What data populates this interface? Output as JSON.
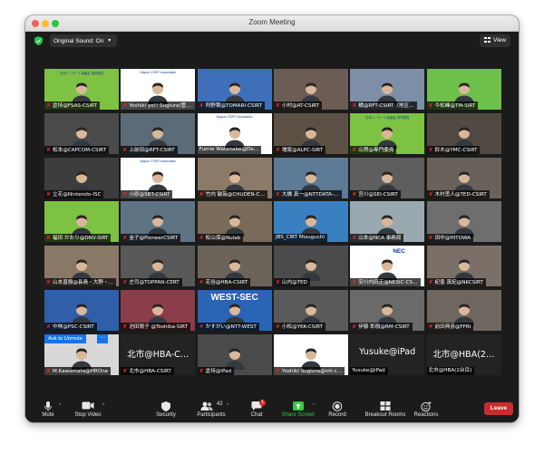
{
  "window": {
    "title": "Zoom Meeting"
  },
  "topbar": {
    "original_sound_label": "Original Sound: On",
    "view_label": "View"
  },
  "tiles": [
    {
      "name": "倉持@FSAS-CSIRT",
      "muted": true,
      "bg": "#7dc242",
      "banner": "日本シーサート協議会 運営委員"
    },
    {
      "name": "Yoshiki yo!! Sugiura(管&…",
      "muted": true,
      "bg": "#ffffff",
      "active": true,
      "banner": "Nippon CSIRT Association"
    },
    {
      "name": "阿野賢@TOMARI-CSIRT",
      "muted": true,
      "bg": "#3f6fb8"
    },
    {
      "name": "小村@AT-CSIRT",
      "muted": true,
      "bg": "#6b5d55"
    },
    {
      "name": "橘@RFT-CSIRT（地区…",
      "muted": true,
      "bg": "#7c8fa6"
    },
    {
      "name": "今松峰@TM-SIRT",
      "muted": true,
      "bg": "#6dc04a"
    },
    {
      "name": "松本@CAPCOM-CSIRT",
      "muted": true,
      "bg": "#4a4a4a"
    },
    {
      "name": "上前田@RFT-CSIRT",
      "muted": true,
      "bg": "#5c6b78"
    },
    {
      "name": "Fumie Watanabe@De…",
      "muted": false,
      "bg": "#ffffff",
      "banner": "Nippon CSIRT Association"
    },
    {
      "name": "増尾@ALPC-SIRT",
      "muted": true,
      "bg": "#5d5145"
    },
    {
      "name": "山賀@専門委員",
      "muted": true,
      "bg": "#7dc242",
      "banner": "日本シーサート協議会 専門委員"
    },
    {
      "name": "鈴木@YMC-CSIRT",
      "muted": true,
      "bg": "#514a43"
    },
    {
      "name": "立花@Nintendo-ISC",
      "muted": true,
      "bg": "#3d3d3d"
    },
    {
      "name": "小原@SBT-CSIRT",
      "muted": true,
      "bg": "#ffffff",
      "banner": "Nippon CSIRT Association"
    },
    {
      "name": "竹内 敏哉@CHUDEN-C…",
      "muted": true,
      "bg": "#8c7a69"
    },
    {
      "name": "大橋 真一@NTTDATA-…",
      "muted": true,
      "bg": "#5d7a96"
    },
    {
      "name": "宮川@SEI-CSIRT",
      "muted": true,
      "bg": "#5e5e5e"
    },
    {
      "name": "木村勇人@TED-CSIRT",
      "muted": true,
      "bg": "#6a625a"
    },
    {
      "name": "福田 かおり@DNV-SIRT",
      "muted": true,
      "bg": "#7dc242"
    },
    {
      "name": "金子@PioneerCSIRT",
      "muted": true,
      "bg": "#5e7384"
    },
    {
      "name": "松山保@Nulab",
      "muted": true,
      "bg": "#7a6a5a"
    },
    {
      "name": "JBS_CIRT Mizuguchi",
      "muted": false,
      "bg": "#3a7fc0"
    },
    {
      "name": "山本@NCA 事務局",
      "muted": true,
      "bg": "#9aa8b0"
    },
    {
      "name": "田中@HITOWA",
      "muted": true,
      "bg": "#6e6e6e"
    },
    {
      "name": "山本直樹@長島・大野・…",
      "muted": true,
      "bg": "#8a7866"
    },
    {
      "name": "庄司@TOPPAN-CERT",
      "muted": true,
      "bg": "#585858"
    },
    {
      "name": "花谷@HBA-CSIRT",
      "muted": true,
      "bg": "#6c6459"
    },
    {
      "name": "山内@TED",
      "muted": true,
      "bg": "#4b4b4b"
    },
    {
      "name": "安川内田正@NESIC-CS…",
      "muted": true,
      "bg": "#ffffff",
      "nec": "NEC"
    },
    {
      "name": "紀香 真紀@NKCSIRT",
      "muted": true,
      "bg": "#7a7068"
    },
    {
      "name": "中林@PSC-CSIRT",
      "muted": true,
      "bg": "#2f5fa8"
    },
    {
      "name": "池田陽子 @Toshiba-SIRT",
      "muted": true,
      "bg": "#8b3d4a"
    },
    {
      "name": "かすがい@NTT-WEST",
      "muted": true,
      "bg": "#2a64b5",
      "westsec": "WEST-SEC"
    },
    {
      "name": "小松@YKK-CSIRT",
      "muted": true,
      "bg": "#5a5a5a"
    },
    {
      "name": "伊藤 彰樹@RM-CSIRT",
      "muted": true,
      "bg": "#6a6a6a"
    },
    {
      "name": "前田典彦@FFRI",
      "muted": true,
      "bg": "#6f675f"
    },
    {
      "name": "M.Kawamata@HROne",
      "muted": true,
      "bg": "#d8d8d8",
      "popup": "Ask to Unmute",
      "popup_more": "⋯"
    },
    {
      "name": "北市@HBA-CSIRT",
      "muted": true,
      "bg": "#232323",
      "bigname": "北市@HBA-C…"
    },
    {
      "name": "倉持@iPad",
      "muted": true,
      "bg": "#4a4a4a"
    },
    {
      "name": "Yoshiki Sugiura@ntt-c…",
      "muted": true,
      "bg": "#ffffff"
    },
    {
      "name": "Yusuke@iPad",
      "muted": false,
      "bg": "#232323",
      "bigname": "Yusuke@iPad"
    },
    {
      "name": "北市@HBA(2台目)",
      "muted": false,
      "bg": "#232323",
      "bigname": "北市@HBA(2…"
    }
  ],
  "toolbar": {
    "mute": "Mute",
    "stop_video": "Stop Video",
    "security": "Security",
    "participants": "Participants",
    "participants_count": "42",
    "chat": "Chat",
    "chat_badge": "1",
    "share_screen": "Share Screen",
    "record": "Record",
    "breakout_rooms": "Breakout Rooms",
    "reactions": "Reactions",
    "leave": "Leave"
  },
  "colors": {
    "accent_green": "#2ecc40",
    "leave_red": "#c92c2c",
    "active_speaker": "#f2e400",
    "muted_red": "#e02828"
  }
}
